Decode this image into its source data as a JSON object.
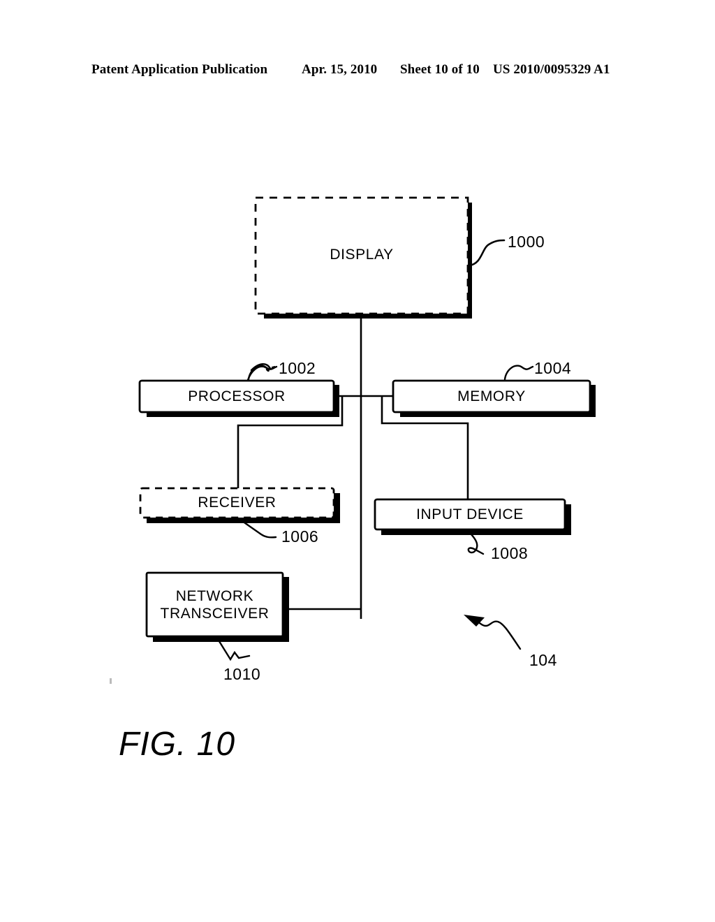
{
  "header": {
    "publication": "Patent Application Publication",
    "date": "Apr. 15, 2010",
    "sheet": "Sheet 10 of 10",
    "patent_number": "US 2010/0095329 A1"
  },
  "figure": {
    "caption": "FIG. 10",
    "assembly_ref": "104",
    "blocks": [
      {
        "id": "display",
        "label": "DISPLAY",
        "ref": "1000",
        "border": "dashed"
      },
      {
        "id": "processor",
        "label": "PROCESSOR",
        "ref": "1002",
        "border": "solid"
      },
      {
        "id": "memory",
        "label": "MEMORY",
        "ref": "1004",
        "border": "solid"
      },
      {
        "id": "receiver",
        "label": "RECEIVER",
        "ref": "1006",
        "border": "dashed"
      },
      {
        "id": "input-device",
        "label": "INPUT DEVICE",
        "ref": "1008",
        "border": "solid"
      },
      {
        "id": "network-transceiver",
        "label": "NETWORK TRANSCEIVER",
        "ref": "1010",
        "border": "solid",
        "label_line_1": "NETWORK",
        "label_line_2": "TRANSCEIVER"
      }
    ],
    "connections": [
      {
        "from": "display",
        "to": "bus"
      },
      {
        "from": "processor",
        "to": "memory"
      },
      {
        "from": "processor",
        "to": "receiver"
      },
      {
        "from": "memory",
        "to": "input-device"
      },
      {
        "from": "network-transceiver",
        "to": "bus"
      }
    ]
  },
  "colors": {
    "ink": "#000000",
    "paper": "#ffffff"
  }
}
